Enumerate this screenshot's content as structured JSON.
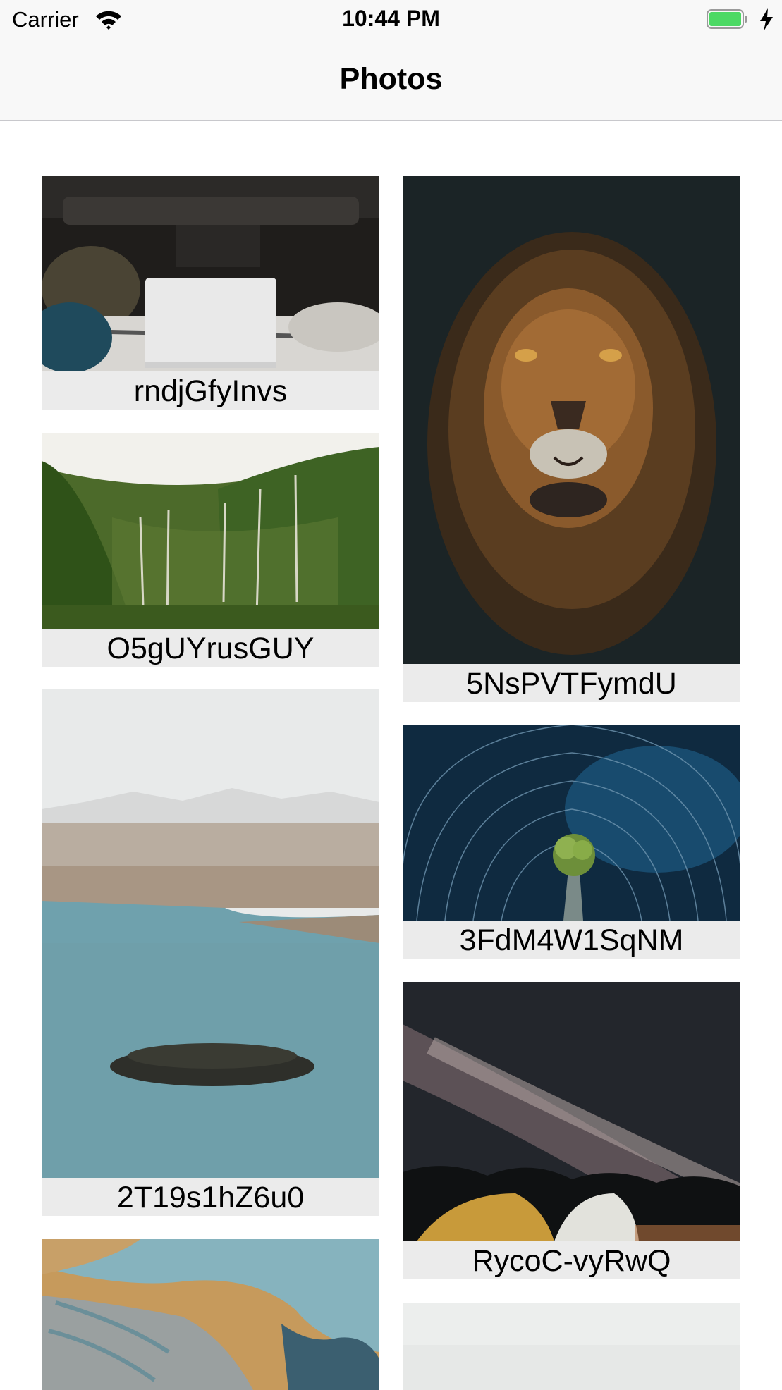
{
  "status_bar": {
    "carrier": "Carrier",
    "time": "10:44 PM",
    "battery_level": 1.0,
    "charging": true,
    "icons": [
      "wifi-icon",
      "battery-icon",
      "charging-bolt-icon"
    ]
  },
  "nav_bar": {
    "title": "Photos"
  },
  "colors": {
    "bar_background": "#f8f8f8",
    "caption_background": "#ebebeb",
    "battery_green": "#4cd964"
  },
  "photos": [
    {
      "id": "rndjGfyInvs",
      "subject": "laptop-in-car-trunk"
    },
    {
      "id": "5NsPVTFymdU",
      "subject": "lion-portrait"
    },
    {
      "id": "O5gUYrusGUY",
      "subject": "green-cliffs-waterfalls"
    },
    {
      "id": "3FdM4W1SqNM",
      "subject": "star-trails-palm-tree"
    },
    {
      "id": "2T19s1hZ6u0",
      "subject": "lake-island-aerial"
    },
    {
      "id": "RycoC-vyRwQ",
      "subject": "milky-way-tents"
    },
    {
      "id": "",
      "subject": "river-delta-aerial"
    },
    {
      "id": "",
      "subject": "pale-sky"
    }
  ]
}
